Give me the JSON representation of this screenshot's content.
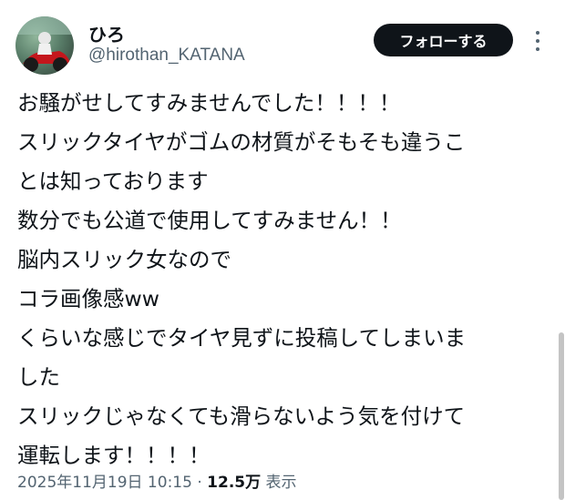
{
  "user": {
    "display_name": "ひろ",
    "handle": "@hirothan_KATANA",
    "avatar_icon": "motorcycle-rider-avatar"
  },
  "actions": {
    "follow_label": "フォローする",
    "more_icon": "more-vertical-icon"
  },
  "tweet": {
    "lines": [
      "お騒がせしてすみませんでした！！！！",
      "スリックタイヤがゴムの材質がそもそも違うこ",
      "とは知っております",
      "数分でも公道で使用してすみません！！",
      "脳内スリック女なので",
      "コラ画像感ww",
      "くらいな感じでタイヤ見ずに投稿してしまいま",
      "した",
      "スリックじゃなくても滑らないよう気を付けて",
      "運転します！！！！"
    ]
  },
  "meta": {
    "timestamp": "2025年11月19日 10:15",
    "separator": "·",
    "views_count": "12.5万",
    "views_label": "表示"
  },
  "colors": {
    "text": "#0f1419",
    "secondary": "#536471",
    "button_bg": "#0f1419",
    "button_text": "#ffffff"
  }
}
